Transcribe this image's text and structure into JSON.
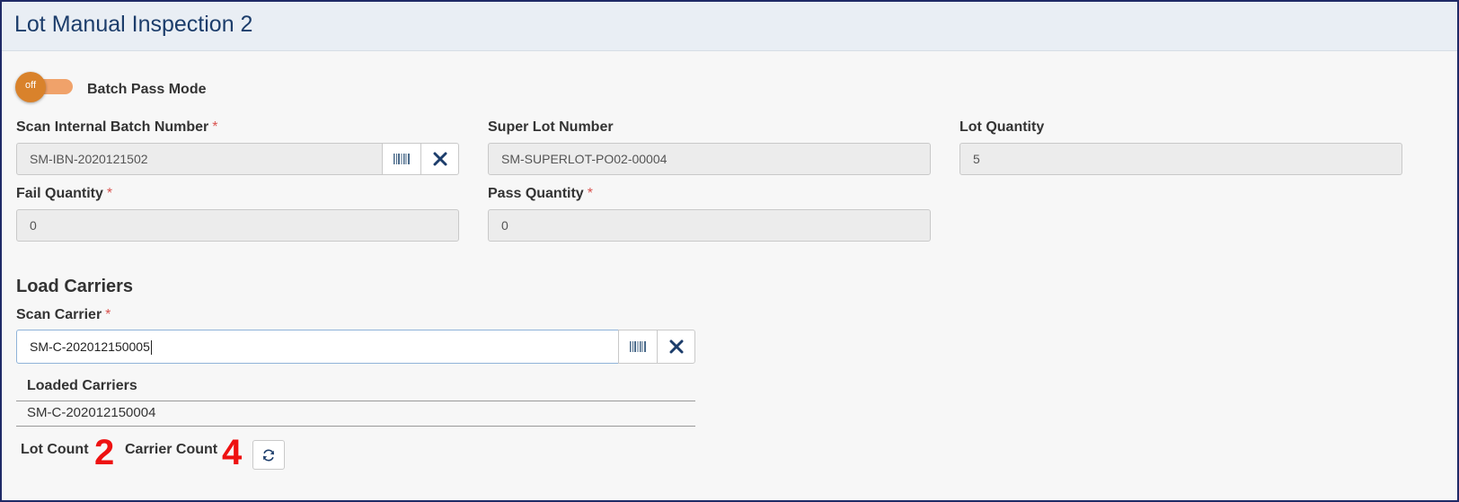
{
  "page": {
    "title": "Lot Manual Inspection 2"
  },
  "toggle": {
    "state": "off",
    "label": "Batch Pass Mode"
  },
  "fields": {
    "internal_batch": {
      "label": "Scan Internal Batch Number",
      "required": "*",
      "value": "SM-IBN-2020121502"
    },
    "super_lot": {
      "label": "Super Lot Number",
      "value": "SM-SUPERLOT-PO02-00004"
    },
    "lot_quantity": {
      "label": "Lot Quantity",
      "value": "5"
    },
    "fail_quantity": {
      "label": "Fail Quantity",
      "required": "*",
      "value": "0"
    },
    "pass_quantity": {
      "label": "Pass Quantity",
      "required": "*",
      "value": "0"
    }
  },
  "load_carriers": {
    "title": "Load Carriers",
    "scan_carrier": {
      "label": "Scan Carrier",
      "required": "*",
      "value": "SM-C-202012150005"
    },
    "table": {
      "header": "Loaded Carriers",
      "rows": [
        "SM-C-202012150004"
      ]
    }
  },
  "counts": {
    "lot_count_label": "Lot Count",
    "lot_count": "2",
    "carrier_count_label": "Carrier Count",
    "carrier_count": "4"
  },
  "icons": {
    "barcode": "barcode-icon",
    "clear": "close-icon",
    "refresh": "refresh-icon"
  },
  "colors": {
    "title": "#1c3d6b",
    "toggle_knob": "#d9822b",
    "toggle_track": "#f0a26a",
    "clear_icon": "#1c3d6b",
    "count_value": "#ee1111",
    "required": "#d9534f"
  }
}
